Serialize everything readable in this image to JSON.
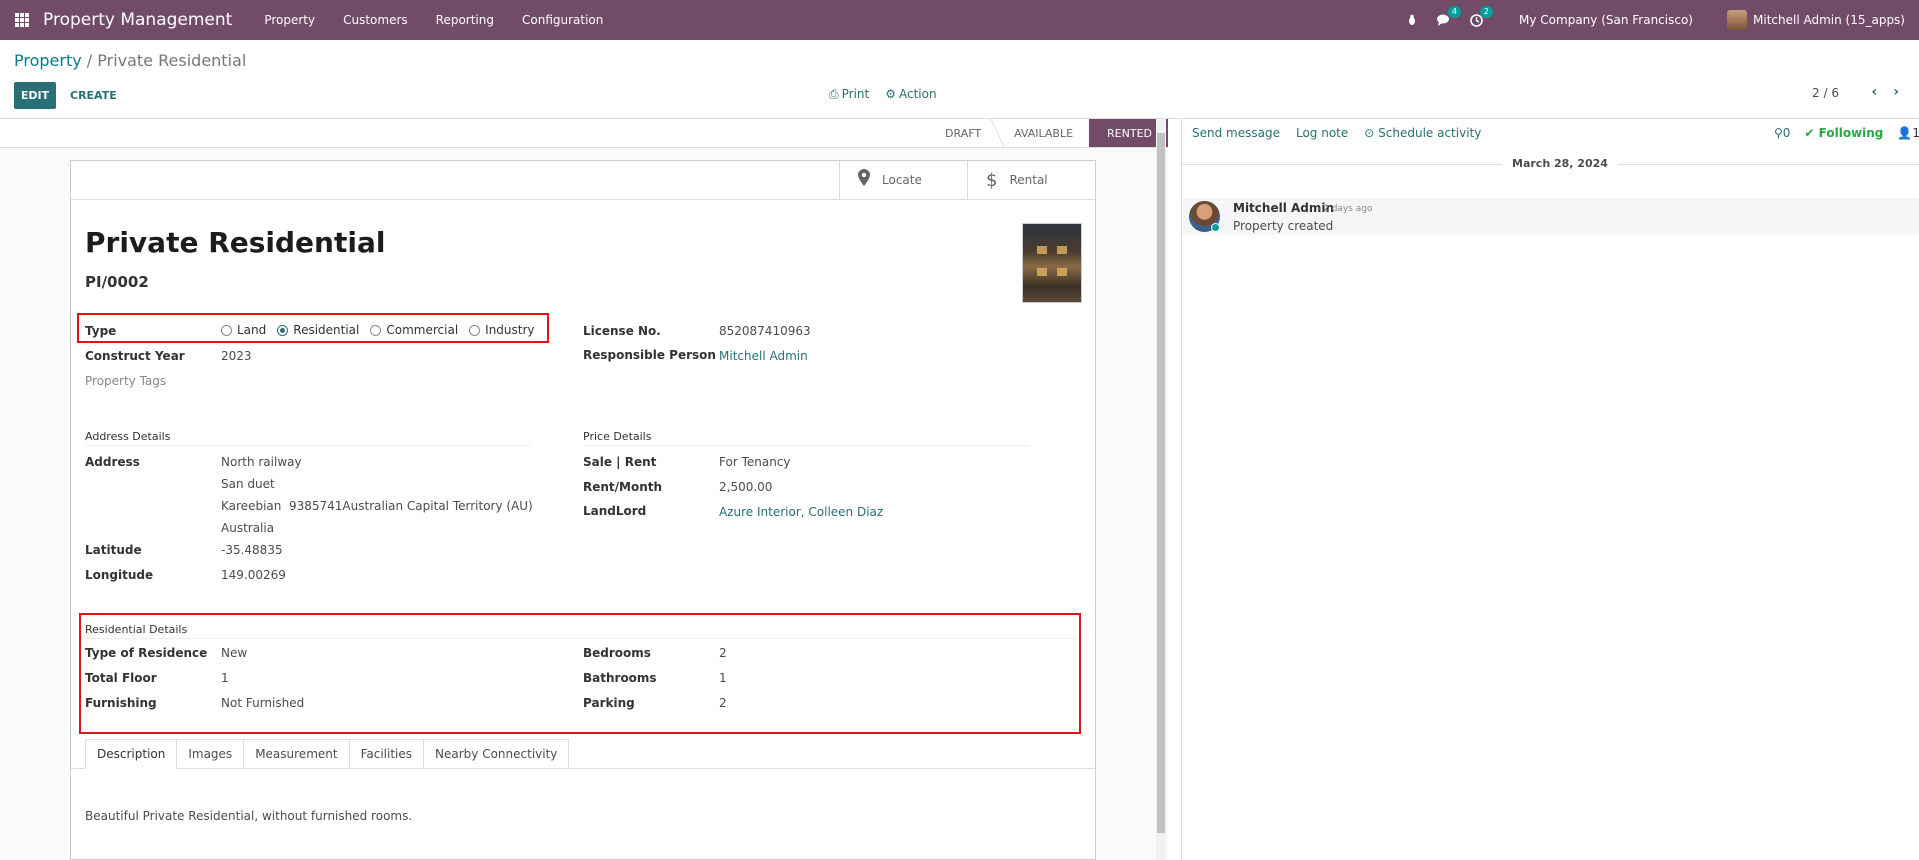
{
  "navbar": {
    "brand": "Property Management",
    "menu": [
      "Property",
      "Customers",
      "Reporting",
      "Configuration"
    ],
    "messages_count": "4",
    "activities_count": "2",
    "company": "My Company (San Francisco)",
    "user": "Mitchell Admin (15_apps)"
  },
  "breadcrumb": {
    "parent": "Property",
    "separator": " / ",
    "current": "Private Residential"
  },
  "toolbar": {
    "edit_label": "EDIT",
    "create_label": "CREATE",
    "print_label": "Print",
    "action_label": "Action",
    "pager": "2 / 6"
  },
  "statusbar": {
    "steps": [
      "DRAFT",
      "AVAILABLE",
      "RENTED"
    ],
    "active": "RENTED"
  },
  "smart_buttons": {
    "locate": "Locate",
    "rental": "Rental"
  },
  "record": {
    "title": "Private Residential",
    "reference": "PI/0002",
    "type_label": "Type",
    "type_options": [
      "Land",
      "Residential",
      "Commercial",
      "Industry"
    ],
    "type_selected": "Residential",
    "construct_year_label": "Construct Year",
    "construct_year": "2023",
    "tags_label": "Property Tags",
    "license_label": "License No.",
    "license": "852087410963",
    "responsible_label": "Responsible Person",
    "responsible": "Mitchell Admin"
  },
  "address": {
    "section": "Address Details",
    "label": "Address",
    "line1": "North railway",
    "line2": "San duet",
    "line3": "Kareebian  9385741Australian Capital Territory (AU)",
    "line4": "Australia",
    "latitude_label": "Latitude",
    "latitude": "-35.48835",
    "longitude_label": "Longitude",
    "longitude": "149.00269"
  },
  "price": {
    "section": "Price Details",
    "sale_rent_label": "Sale | Rent",
    "sale_rent": "For Tenancy",
    "rent_month_label": "Rent/Month",
    "rent_month": "2,500.00",
    "landlord_label": "LandLord",
    "landlord": "Azure Interior, Colleen Diaz"
  },
  "residential": {
    "section": "Residential Details",
    "type_label": "Type of Residence",
    "type": "New",
    "floor_label": "Total Floor",
    "floor": "1",
    "furnishing_label": "Furnishing",
    "furnishing": "Not Furnished",
    "bedrooms_label": "Bedrooms",
    "bedrooms": "2",
    "bathrooms_label": "Bathrooms",
    "bathrooms": "1",
    "parking_label": "Parking",
    "parking": "2"
  },
  "tabs": [
    "Description",
    "Images",
    "Measurement",
    "Facilities",
    "Nearby Connectivity"
  ],
  "description": "Beautiful Private Residential, without furnished rooms.",
  "chatter": {
    "send_message": "Send message",
    "log_note": "Log note",
    "schedule_activity": "Schedule activity",
    "attachments": "0",
    "following": "Following",
    "followers": "1",
    "date": "March 28, 2024",
    "message_author": "Mitchell Admin",
    "message_date": "- 2 days ago",
    "message_body": "Property created"
  },
  "colors": {
    "primary": "#714B67",
    "accent": "#2a6f75",
    "highlight": "#e0131a"
  }
}
